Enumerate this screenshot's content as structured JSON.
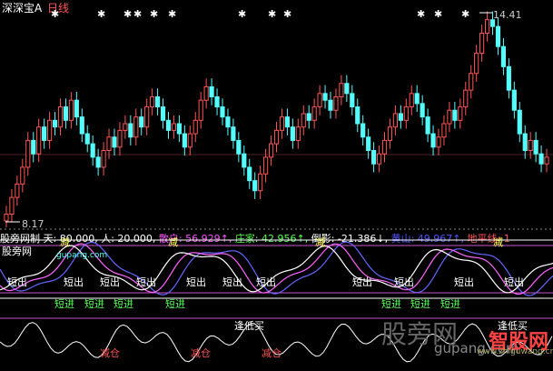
{
  "header": {
    "stock_name": "深深宝A",
    "period": "日线",
    "high_price": "14.41",
    "low_price": "8.17"
  },
  "indicator_bar": {
    "label": "股旁网制",
    "items": [
      {
        "text": "天: 80.000,",
        "color": "#ffffff"
      },
      {
        "text": "人: 20.000,",
        "color": "#ffffff"
      },
      {
        "text": "散户: 56.929↑,",
        "color": "#ff55ff"
      },
      {
        "text": "庄家: 42.956↑,",
        "color": "#55ff55"
      },
      {
        "text": "倒影: -21.386↓,",
        "color": "#ffffff"
      },
      {
        "text": "黄山: 49.967↑,",
        "color": "#5555ff"
      },
      {
        "text": "地平线: 1",
        "color": "#ff5555"
      }
    ]
  },
  "indicator1": {
    "label": "股旁网",
    "watermark": "gupang.com",
    "short_out": "短出",
    "short_in": "短进",
    "reduce": "减",
    "reduce_in": "减进"
  },
  "indicator2": {
    "buy_note": "逢低买",
    "reduce_warehouse": "减仓",
    "full": "满"
  },
  "watermarks": {
    "site_cn": "股旁网",
    "site_url": "gupang.com",
    "brand": "智股网",
    "brand_url": "www.zhiguwang.cn"
  },
  "colors": {
    "up": "#ff5555",
    "down": "#55ffff",
    "bg": "#000000"
  },
  "chart_data": {
    "type": "candlestick",
    "ylim": [
      8.17,
      14.41
    ],
    "closes": [
      8.4,
      8.9,
      9.3,
      9.8,
      10.6,
      10.2,
      11.0,
      10.6,
      11.2,
      11.0,
      11.6,
      11.2,
      11.8,
      11.3,
      10.8,
      10.5,
      10.1,
      9.8,
      10.3,
      10.7,
      10.4,
      10.9,
      11.1,
      10.7,
      11.3,
      11.0,
      11.6,
      11.9,
      11.6,
      11.2,
      10.9,
      11.1,
      10.8,
      10.4,
      10.8,
      11.2,
      11.8,
      12.2,
      11.9,
      11.6,
      11.3,
      11.0,
      10.6,
      10.2,
      9.8,
      9.4,
      9.1,
      9.6,
      10.1,
      10.5,
      10.9,
      11.3,
      11.0,
      10.6,
      11.0,
      11.4,
      11.2,
      11.6,
      12.0,
      11.8,
      11.5,
      11.9,
      12.3,
      12.0,
      11.6,
      11.1,
      10.7,
      10.3,
      9.9,
      10.2,
      10.6,
      11.0,
      11.4,
      11.2,
      11.6,
      12.0,
      11.7,
      11.3,
      10.8,
      10.4,
      10.7,
      11.1,
      11.5,
      11.2,
      11.6,
      12.1,
      12.6,
      13.2,
      13.8,
      14.2,
      14.0,
      13.4,
      12.8,
      12.1,
      11.5,
      10.8,
      10.3,
      10.6,
      10.2,
      9.9,
      10.1
    ]
  }
}
